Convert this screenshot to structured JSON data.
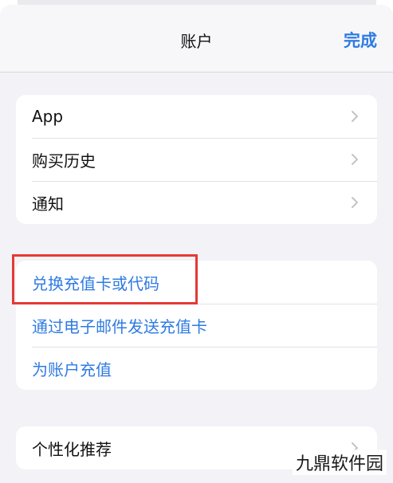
{
  "nav": {
    "title": "账户",
    "done": "完成"
  },
  "group1": {
    "items": [
      {
        "label": "App"
      },
      {
        "label": "购买历史"
      },
      {
        "label": "通知"
      }
    ]
  },
  "group2": {
    "items": [
      {
        "label": "兑换充值卡或代码"
      },
      {
        "label": "通过电子邮件发送充值卡"
      },
      {
        "label": "为账户充值"
      }
    ]
  },
  "group3": {
    "items": [
      {
        "label": "个性化推荐"
      }
    ]
  },
  "watermark": "九鼎软件园",
  "colors": {
    "accent": "#2f7be2",
    "highlight": "#e53935",
    "background": "#f2f2f7"
  }
}
